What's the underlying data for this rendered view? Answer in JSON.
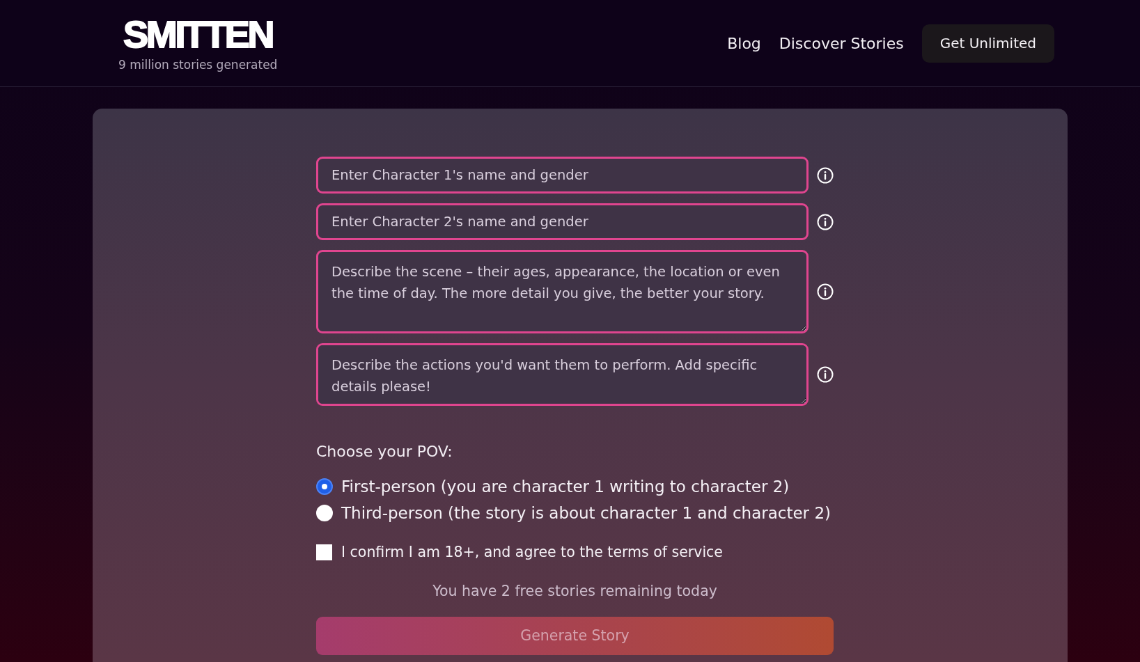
{
  "header": {
    "logo": "SMITTEN",
    "tagline": "9 million stories generated",
    "nav_links": [
      "Blog",
      "Discover Stories"
    ],
    "cta_button": "Get Unlimited"
  },
  "form": {
    "fields": [
      {
        "kind": "input",
        "placeholder": "Enter Character 1's name and gender"
      },
      {
        "kind": "input",
        "placeholder": "Enter Character 2's name and gender"
      },
      {
        "kind": "textarea",
        "placeholder": "Describe the scene – their ages, appearance, the location or even the time of day. The more detail you give, the better your story."
      },
      {
        "kind": "textarea",
        "placeholder": "Describe the actions you'd want them to perform. Add specific details please!"
      }
    ],
    "pov": {
      "label": "Choose your POV:",
      "options": [
        {
          "label": "First-person (you are character 1 writing to character 2)",
          "selected": true
        },
        {
          "label": "Third-person (the story is about character 1 and character 2)",
          "selected": false
        }
      ]
    },
    "age_confirmation": {
      "label": "I confirm I am 18+, and agree to the terms of service",
      "checked": false
    },
    "remaining_note": "You have 2 free stories remaining today",
    "generate_button": {
      "label": "Generate Story",
      "disabled": true
    }
  }
}
